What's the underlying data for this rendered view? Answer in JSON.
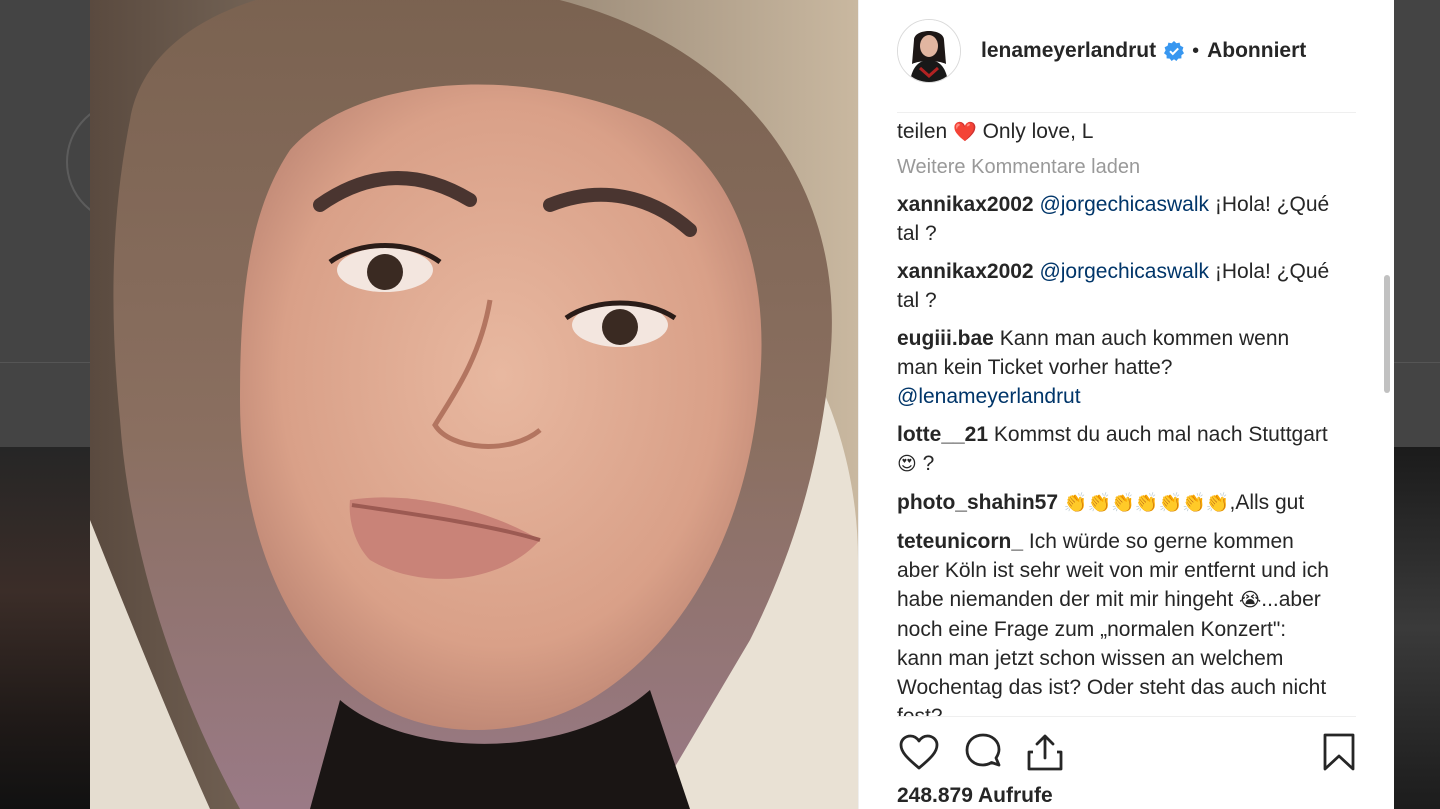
{
  "post": {
    "username": "lenameyerlandrut",
    "follow_status": "Abonniert",
    "separator": "•",
    "caption_tail": {
      "before": "teilen",
      "emoji": "❤️",
      "after": "Only love, L"
    },
    "load_more": "Weitere Kommentare laden",
    "views": "248.879 Aufrufe"
  },
  "comments": [
    {
      "user": "xannikax2002",
      "mention": "@jorgechicaswalk",
      "text": "¡Hola! ¿Qué tal ?"
    },
    {
      "user": "xannikax2002",
      "mention": "@jorgechicaswalk",
      "text": "¡Hola! ¿Qué tal ?"
    },
    {
      "user": "eugiii.bae",
      "text": "Kann man auch kommen wenn man kein Ticket vorher hatte?",
      "mention": "@lenameyerlandrut"
    },
    {
      "user": "lotte__21",
      "text": "Kommst du auch mal nach Stuttgart",
      "emoji": "😍",
      "after": "?"
    },
    {
      "user": "photo_shahin57",
      "emoji": "👏👏👏👏👏👏👏",
      "text": ",Alls gut"
    },
    {
      "user": "teteunicorn_",
      "text": "Ich würde so gerne kommen aber Köln ist sehr weit von mir entfernt und ich habe niemanden der mit mir hingeht",
      "emoji": "😭",
      "after": "...aber noch eine Frage zum „normalen Konzert\": kann man jetzt schon wissen an welchem Wochentag das ist? Oder steht das auch nicht fest?"
    }
  ],
  "icons": {
    "like": "heart-icon",
    "comment": "comment-icon",
    "share": "share-icon",
    "save": "bookmark-icon",
    "verified": "verified-badge-icon"
  },
  "colors": {
    "text": "#262626",
    "muted": "#999999",
    "mention": "#003569",
    "verified": "#3897f0"
  }
}
